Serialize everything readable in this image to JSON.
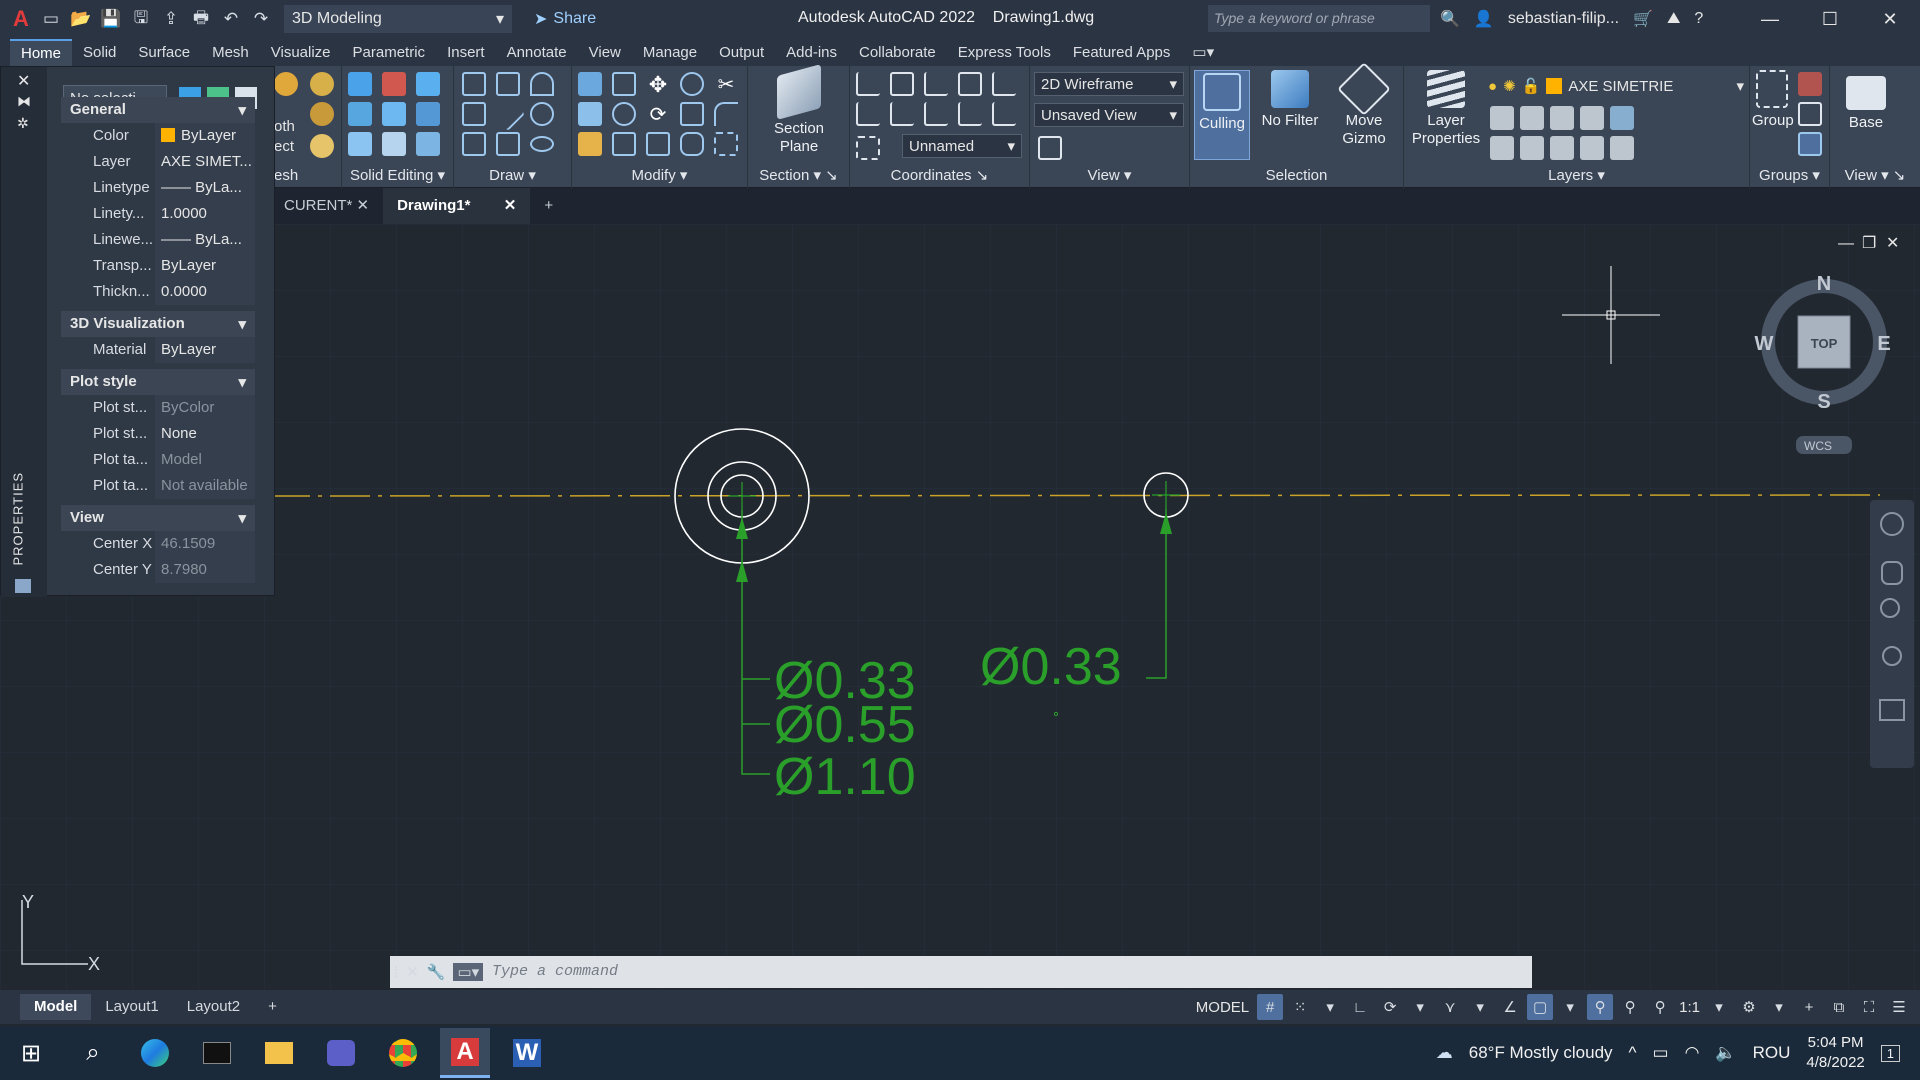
{
  "titlebar": {
    "workspace": "3D Modeling",
    "share": "Share",
    "title": "Autodesk AutoCAD 2022",
    "file": "Drawing1.dwg",
    "search_placeholder": "Type a keyword or phrase",
    "user": "sebastian-filip..."
  },
  "ribbon_tabs": [
    "Home",
    "Solid",
    "Surface",
    "Mesh",
    "Visualize",
    "Parametric",
    "Insert",
    "Annotate",
    "View",
    "Manage",
    "Output",
    "Add-ins",
    "Collaborate",
    "Express Tools",
    "Featured Apps"
  ],
  "ribbon": {
    "solid_editing": "Solid Editing",
    "draw": "Draw",
    "modify": "Modify",
    "section_plane": "Section Plane",
    "section": "Section",
    "coordinates": "Coordinates",
    "view": "View",
    "visual_style": "2D Wireframe",
    "named_view": "Unsaved View",
    "ucs": "Unnamed",
    "culling": "Culling",
    "no_filter": "No Filter",
    "move_gizmo": "Move Gizmo",
    "selection": "Selection",
    "layer_properties": "Layer Properties",
    "current_layer": "AXE SIMETRIE",
    "layers": "Layers",
    "group": "Group",
    "groups": "Groups",
    "base": "Base",
    "view2": "View",
    "mesh_partial": "esh",
    "oth_partial": "oth",
    "ect_partial": "ect"
  },
  "doc_tabs": [
    "CURENT*",
    "Drawing1*"
  ],
  "properties": {
    "selection": "No selecti...",
    "side_label": "PROPERTIES",
    "general": "General",
    "general_rows": [
      {
        "k": "Color",
        "v": "ByLayer"
      },
      {
        "k": "Layer",
        "v": "AXE SIMET..."
      },
      {
        "k": "Linetype",
        "v": "—— ByLa..."
      },
      {
        "k": "Linety...",
        "v": "1.0000"
      },
      {
        "k": "Linewe...",
        "v": "—— ByLa..."
      },
      {
        "k": "Transp...",
        "v": "ByLayer"
      },
      {
        "k": "Thickn...",
        "v": "0.0000"
      }
    ],
    "viz": "3D Visualization",
    "viz_rows": [
      {
        "k": "Material",
        "v": "ByLayer"
      }
    ],
    "plot": "Plot style",
    "plot_rows": [
      {
        "k": "Plot st...",
        "v": "ByColor"
      },
      {
        "k": "Plot st...",
        "v": "None"
      },
      {
        "k": "Plot ta...",
        "v": "Model"
      },
      {
        "k": "Plot ta...",
        "v": "Not available"
      }
    ],
    "view": "View",
    "view_rows": [
      {
        "k": "Center X",
        "v": "46.1509"
      },
      {
        "k": "Center Y",
        "v": "8.7980"
      }
    ]
  },
  "drawing": {
    "dim1": "Ø0.33",
    "dim2": "Ø0.55",
    "dim3": "Ø1.10",
    "dim4": "Ø0.33"
  },
  "viewcube": {
    "n": "N",
    "s": "S",
    "e": "E",
    "w": "W",
    "top": "TOP",
    "wcs": "WCS"
  },
  "ucs": {
    "x": "X",
    "y": "Y"
  },
  "command": {
    "placeholder": "Type a command"
  },
  "layout_tabs": [
    "Model",
    "Layout1",
    "Layout2"
  ],
  "status": {
    "model": "MODEL",
    "scale": "1:1"
  },
  "taskbar": {
    "weather": "68°F  Mostly cloudy",
    "lang": "ROU",
    "time": "5:04 PM",
    "date": "4/8/2022",
    "notif": "1"
  }
}
